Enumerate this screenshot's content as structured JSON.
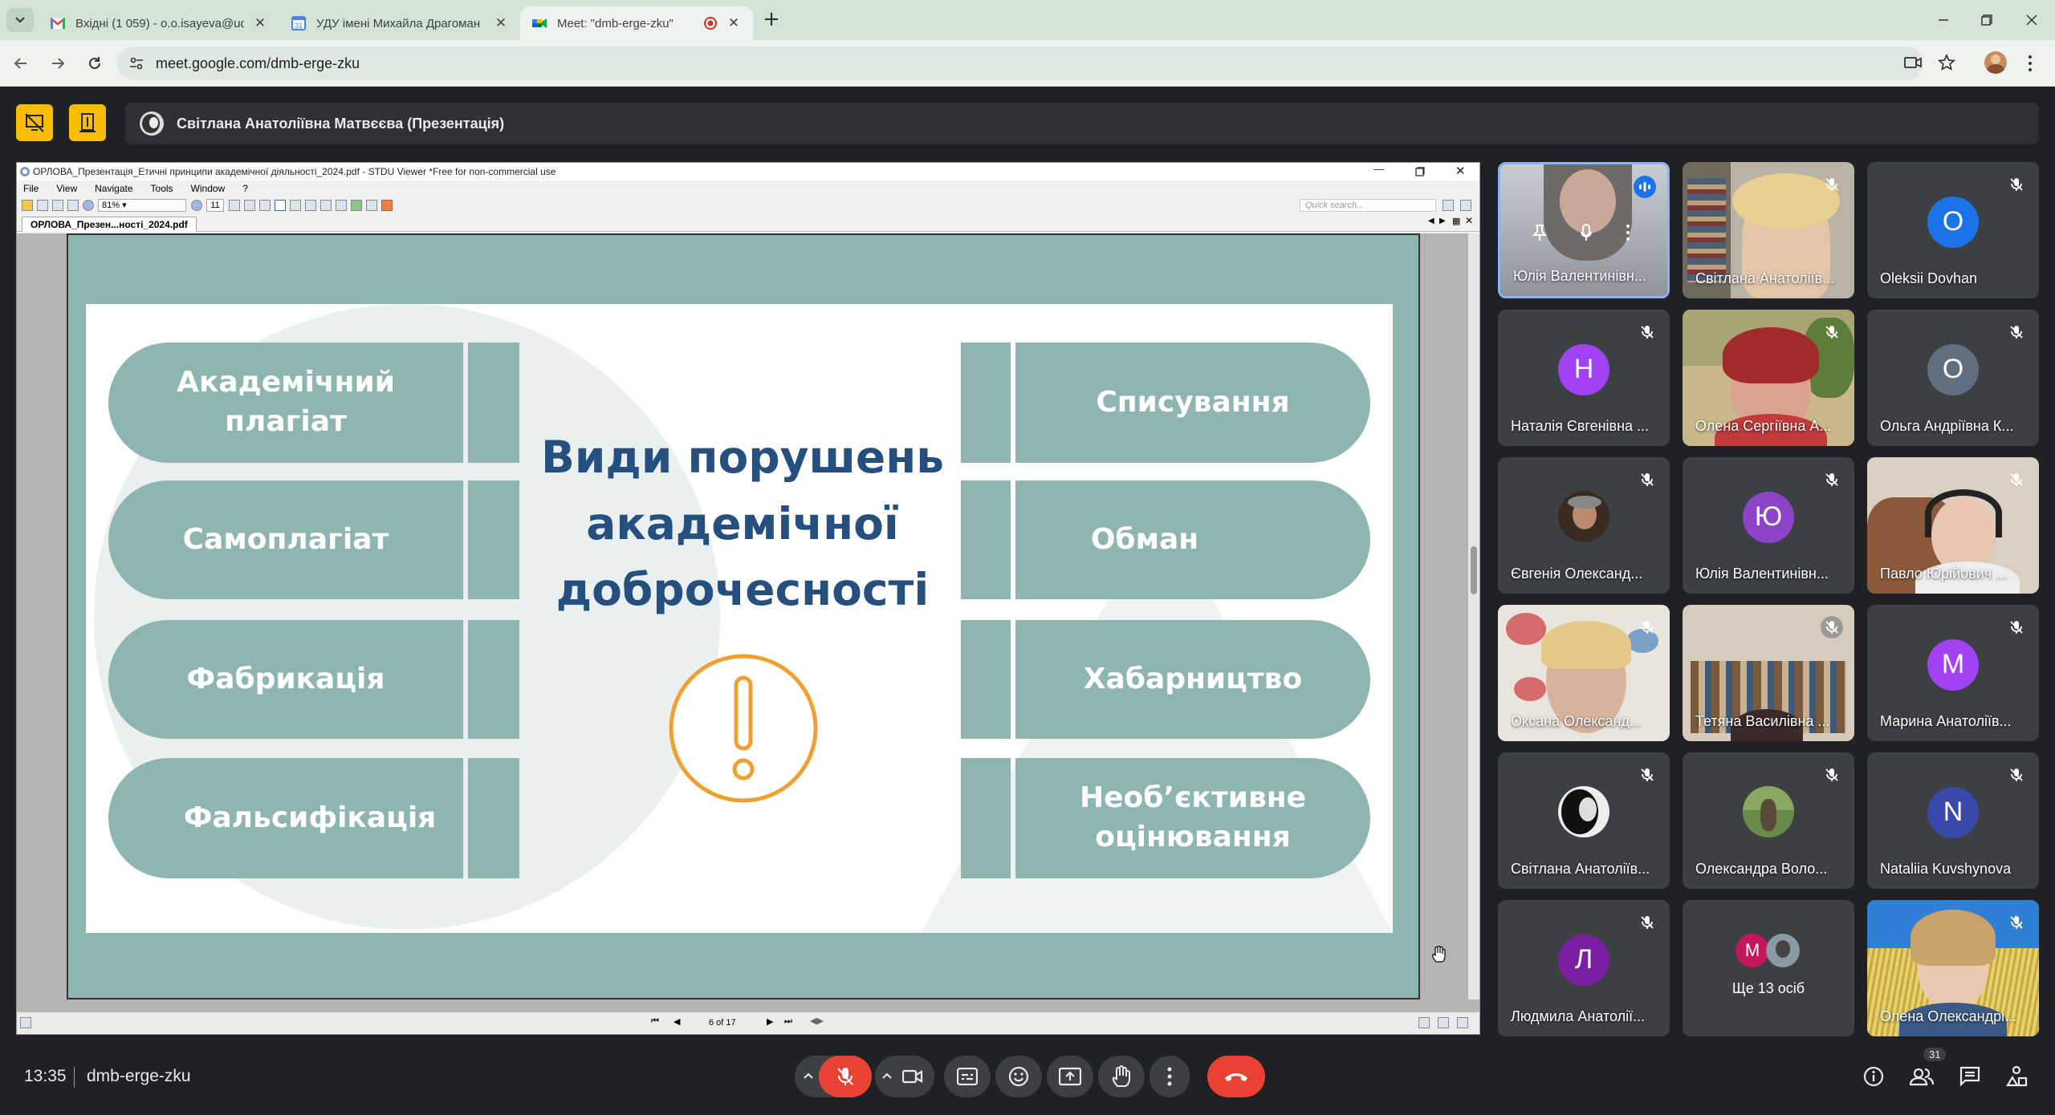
{
  "browser": {
    "tabs": [
      {
        "title": "Вхідні (1 059) - o.o.isayeva@ud",
        "icon": "gmail-icon"
      },
      {
        "title": "УДУ імені Михайла Драгоман",
        "icon": "calendar-icon"
      },
      {
        "title": "Meet: \"dmb-erge-zku\"",
        "icon": "meet-icon",
        "active": true
      }
    ],
    "url": "meet.google.com/dmb-erge-zku"
  },
  "meet": {
    "presenter": "Світлана Анатоліївна Матвєєва (Презентація)",
    "time": "13:35",
    "meeting_code": "dmb-erge-zku",
    "people_count": "31"
  },
  "viewer": {
    "window_title": "ОРЛОВА_Презентація_Етичні принципи академічної діяльності_2024.pdf - STDU Viewer *Free for non-commercial use",
    "menu": [
      "File",
      "View",
      "Navigate",
      "Tools",
      "Window",
      "?"
    ],
    "zoom": "81%",
    "page_field": "11",
    "search_placeholder": "Quick search...",
    "doc_tab": "ОРЛОВА_Презен...ності_2024.pdf",
    "page_status": "6 of 17"
  },
  "slide": {
    "title": "Види порушень академічної доброчесності",
    "left_items": [
      "Академічний плагіат",
      "Самоплагіат",
      "Фабрикація",
      "Фальсифікація"
    ],
    "right_items": [
      "Списування",
      "Обман",
      "Хабарництво",
      "Необ’єктивне оцінювання"
    ],
    "pill_color": "#8eb5b0",
    "title_color": "#254f7f",
    "icon_color": "#f0a030"
  },
  "participants": [
    {
      "name": "Юлія Валентинівн...",
      "type": "video",
      "speaking": true
    },
    {
      "name": "Світлана Анатоліїв...",
      "type": "video"
    },
    {
      "name": "Oleksii Dovhan",
      "type": "avatar",
      "letter": "O",
      "color": "#1a73e8"
    },
    {
      "name": "Наталія Євгенівна ...",
      "type": "avatar",
      "letter": "Н",
      "color": "#a142f4"
    },
    {
      "name": "Олена Сергіївна А...",
      "type": "video"
    },
    {
      "name": "Ольга Андріївна К...",
      "type": "avatar",
      "letter": "О",
      "color": "#5f6f7f"
    },
    {
      "name": "Євгенія Олександ...",
      "type": "photo"
    },
    {
      "name": "Юлія Валентинівн...",
      "type": "avatar",
      "letter": "Ю",
      "color": "#8e44c9"
    },
    {
      "name": "Павло Юрійович ...",
      "type": "video"
    },
    {
      "name": "Оксана Олександ...",
      "type": "video"
    },
    {
      "name": "Тетяна Василівна ...",
      "type": "video"
    },
    {
      "name": "Марина Анатоліїв...",
      "type": "avatar",
      "letter": "М",
      "color": "#a142f4"
    },
    {
      "name": "Світлана Анатоліїв...",
      "type": "photo"
    },
    {
      "name": "Олександра Воло...",
      "type": "photo"
    },
    {
      "name": "Nataliia Kuvshynova",
      "type": "avatar",
      "letter": "N",
      "color": "#3949ab"
    },
    {
      "name": "Людмила Анатолії...",
      "type": "avatar",
      "letter": "Л",
      "color": "#7b1fa2"
    },
    {
      "name": "Ще 13 осіб",
      "type": "more",
      "letter": "М"
    },
    {
      "name": "Олена Олександрі...",
      "type": "video"
    }
  ]
}
